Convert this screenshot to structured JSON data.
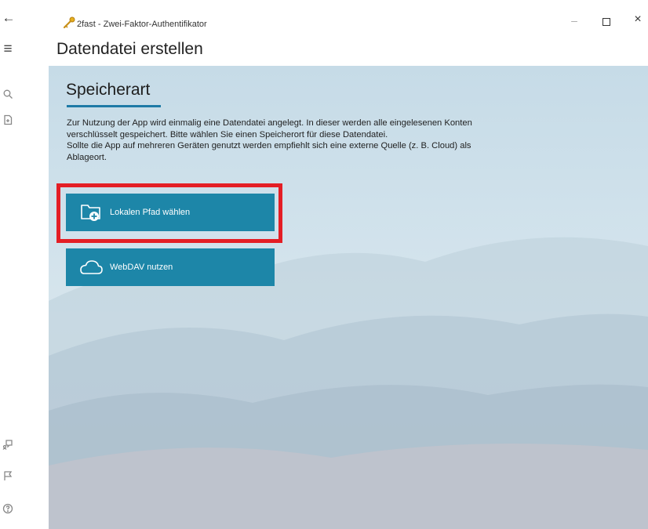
{
  "titlebar": {
    "app_title": "2fast - Zwei-Faktor-Authentifikator",
    "back_glyph": "←",
    "minimize_glyph": "–",
    "close_glyph": "×"
  },
  "header": {
    "menu_glyph": "≡",
    "page_title": "Datendatei erstellen"
  },
  "nav_rail": {
    "items": [
      "search-icon",
      "open-file-icon",
      "feedback-icon",
      "flag-icon",
      "help-icon"
    ]
  },
  "main": {
    "section_title": "Speicherart",
    "description_line1": "Zur Nutzung der App wird einmalig eine Datendatei angelegt. In dieser werden alle eingelesenen Konten",
    "description_line2": "verschlüsselt gespeichert. Bitte wählen Sie einen Speicherort für diese Datendatei.",
    "description_line3": "Sollte die App auf mehreren Geräten genutzt werden empfiehlt sich eine externe Quelle (z. B. Cloud) als",
    "description_line4": "Ablageort.",
    "buttons": {
      "local_path_label": "Lokalen Pfad wählen",
      "webdav_label": "WebDAV nutzen"
    }
  },
  "colors": {
    "accent": "#1d86a8",
    "underline": "#1e7aa6",
    "highlight": "#e41e25"
  }
}
